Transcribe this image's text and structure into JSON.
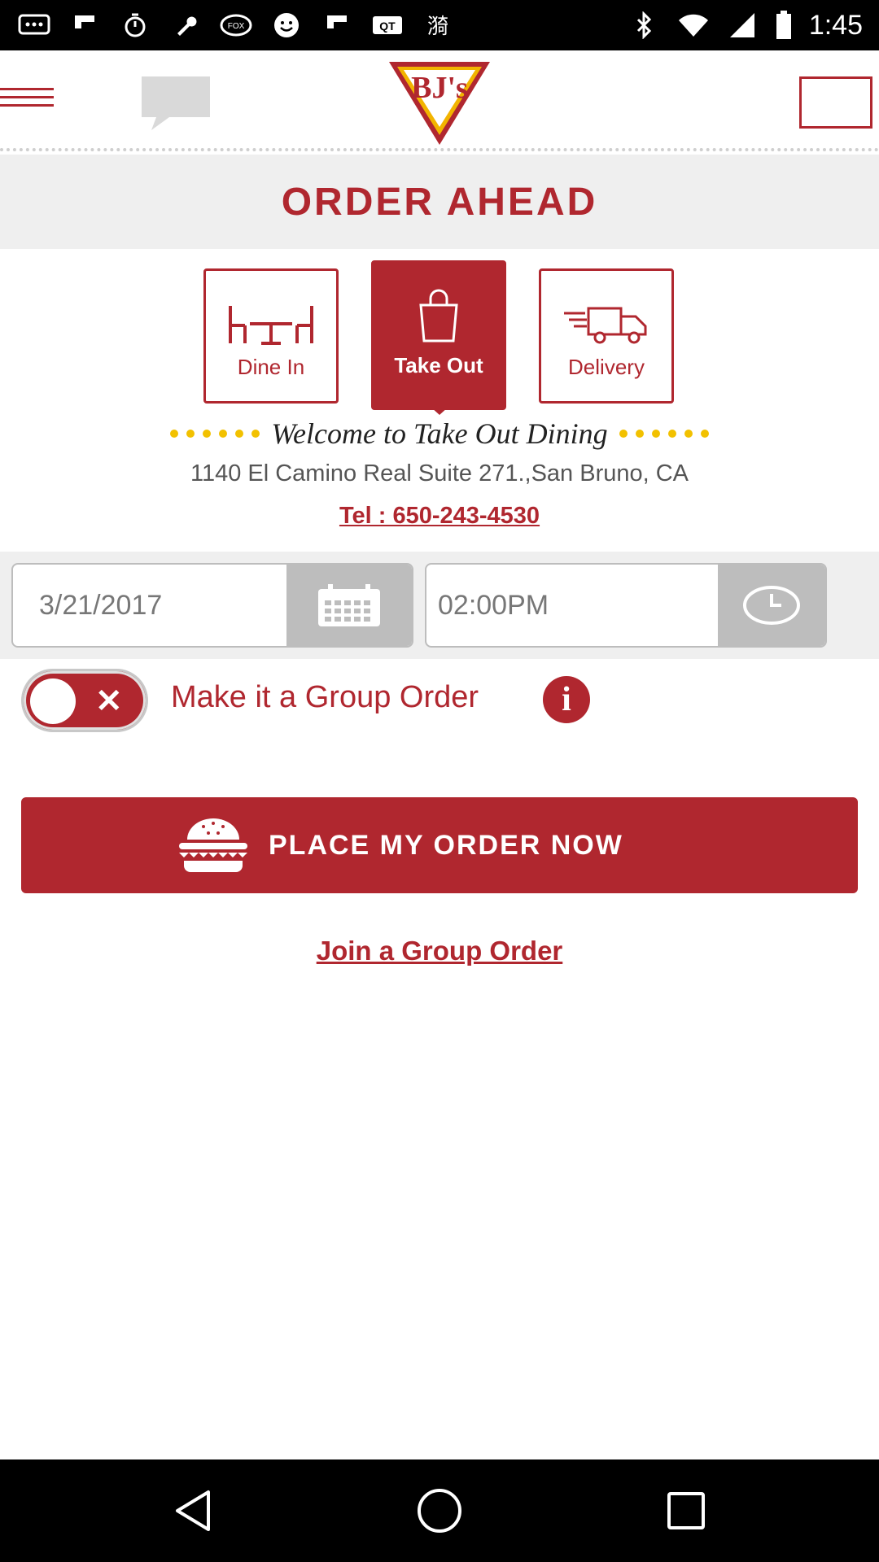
{
  "status_bar": {
    "time": "1:45",
    "icons": [
      "message-icon",
      "flipboard-icon",
      "timer-icon",
      "wrench-icon",
      "fox-sports-icon",
      "smiley-icon",
      "flipboard-icon",
      "qt-icon",
      "hike-icon",
      "bluetooth-icon",
      "wifi-icon",
      "signal-icon",
      "battery-icon"
    ]
  },
  "header": {
    "logo_text": "BJ's",
    "menu_icon": "hamburger-icon",
    "chat_icon": "chat-icon"
  },
  "page": {
    "title": "ORDER AHEAD"
  },
  "order_types": [
    {
      "label": "Dine In",
      "icon": "table-icon",
      "active": false
    },
    {
      "label": "Take Out",
      "icon": "bag-icon",
      "active": true
    },
    {
      "label": "Delivery",
      "icon": "truck-icon",
      "active": false
    }
  ],
  "location": {
    "welcome": "Welcome to Take Out Dining",
    "address": "1140 El Camino Real Suite 271.,San Bruno, CA",
    "phone": "Tel : 650-243-4530"
  },
  "schedule": {
    "date": "3/21/2017",
    "time": "02:00PM"
  },
  "group_order": {
    "label": "Make it a Group Order",
    "enabled": false,
    "info_glyph": "i"
  },
  "actions": {
    "place_order": "PLACE MY ORDER NOW",
    "join_group": "Join a Group Order"
  },
  "colors": {
    "brand": "#b0272f",
    "accent_dots": "#f2c100"
  }
}
